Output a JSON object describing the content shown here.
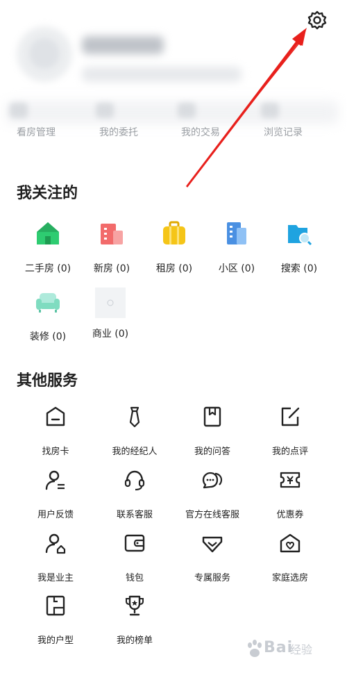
{
  "header": {
    "settings_icon": "gear-icon",
    "annotation_color": "#e8201c"
  },
  "quick_tabs": [
    {
      "label": "看房管理"
    },
    {
      "label": "我的委托"
    },
    {
      "label": "我的交易"
    },
    {
      "label": "浏览记录"
    }
  ],
  "follow": {
    "title": "我关注的",
    "items": [
      {
        "label": "二手房 (0)",
        "icon": "house-icon",
        "color": "#2ecc71"
      },
      {
        "label": "新房 (0)",
        "icon": "building-icon",
        "color": "#f26b6b"
      },
      {
        "label": "租房 (0)",
        "icon": "suitcase-icon",
        "color": "#f5c518"
      },
      {
        "label": "小区 (0)",
        "icon": "apartment-icon",
        "color": "#4a90e2"
      },
      {
        "label": "搜索 (0)",
        "icon": "folder-search-icon",
        "color": "#1fa3e0"
      },
      {
        "label": "装修 (0)",
        "icon": "sofa-icon",
        "color": "#7fdcc0"
      },
      {
        "label": "商业 (0)",
        "icon": "placeholder-icon",
        "color": "#e9ecef"
      }
    ]
  },
  "services": {
    "title": "其他服务",
    "items": [
      {
        "label": "找房卡",
        "icon": "card-icon"
      },
      {
        "label": "我的经纪人",
        "icon": "tie-icon"
      },
      {
        "label": "我的问答",
        "icon": "bookmark-icon"
      },
      {
        "label": "我的点评",
        "icon": "edit-icon"
      },
      {
        "label": "用户反馈",
        "icon": "user-feedback-icon"
      },
      {
        "label": "联系客服",
        "icon": "headset-icon"
      },
      {
        "label": "官方在线客服",
        "icon": "chat-icon"
      },
      {
        "label": "优惠券",
        "icon": "coupon-icon"
      },
      {
        "label": "我是业主",
        "icon": "owner-icon"
      },
      {
        "label": "钱包",
        "icon": "wallet-icon"
      },
      {
        "label": "专属服务",
        "icon": "heart-shield-icon"
      },
      {
        "label": "家庭选房",
        "icon": "family-house-icon"
      },
      {
        "label": "我的户型",
        "icon": "floorplan-icon"
      },
      {
        "label": "我的榜单",
        "icon": "trophy-icon"
      }
    ]
  },
  "watermark": {
    "text": "Bai",
    "subtext": "经验"
  }
}
